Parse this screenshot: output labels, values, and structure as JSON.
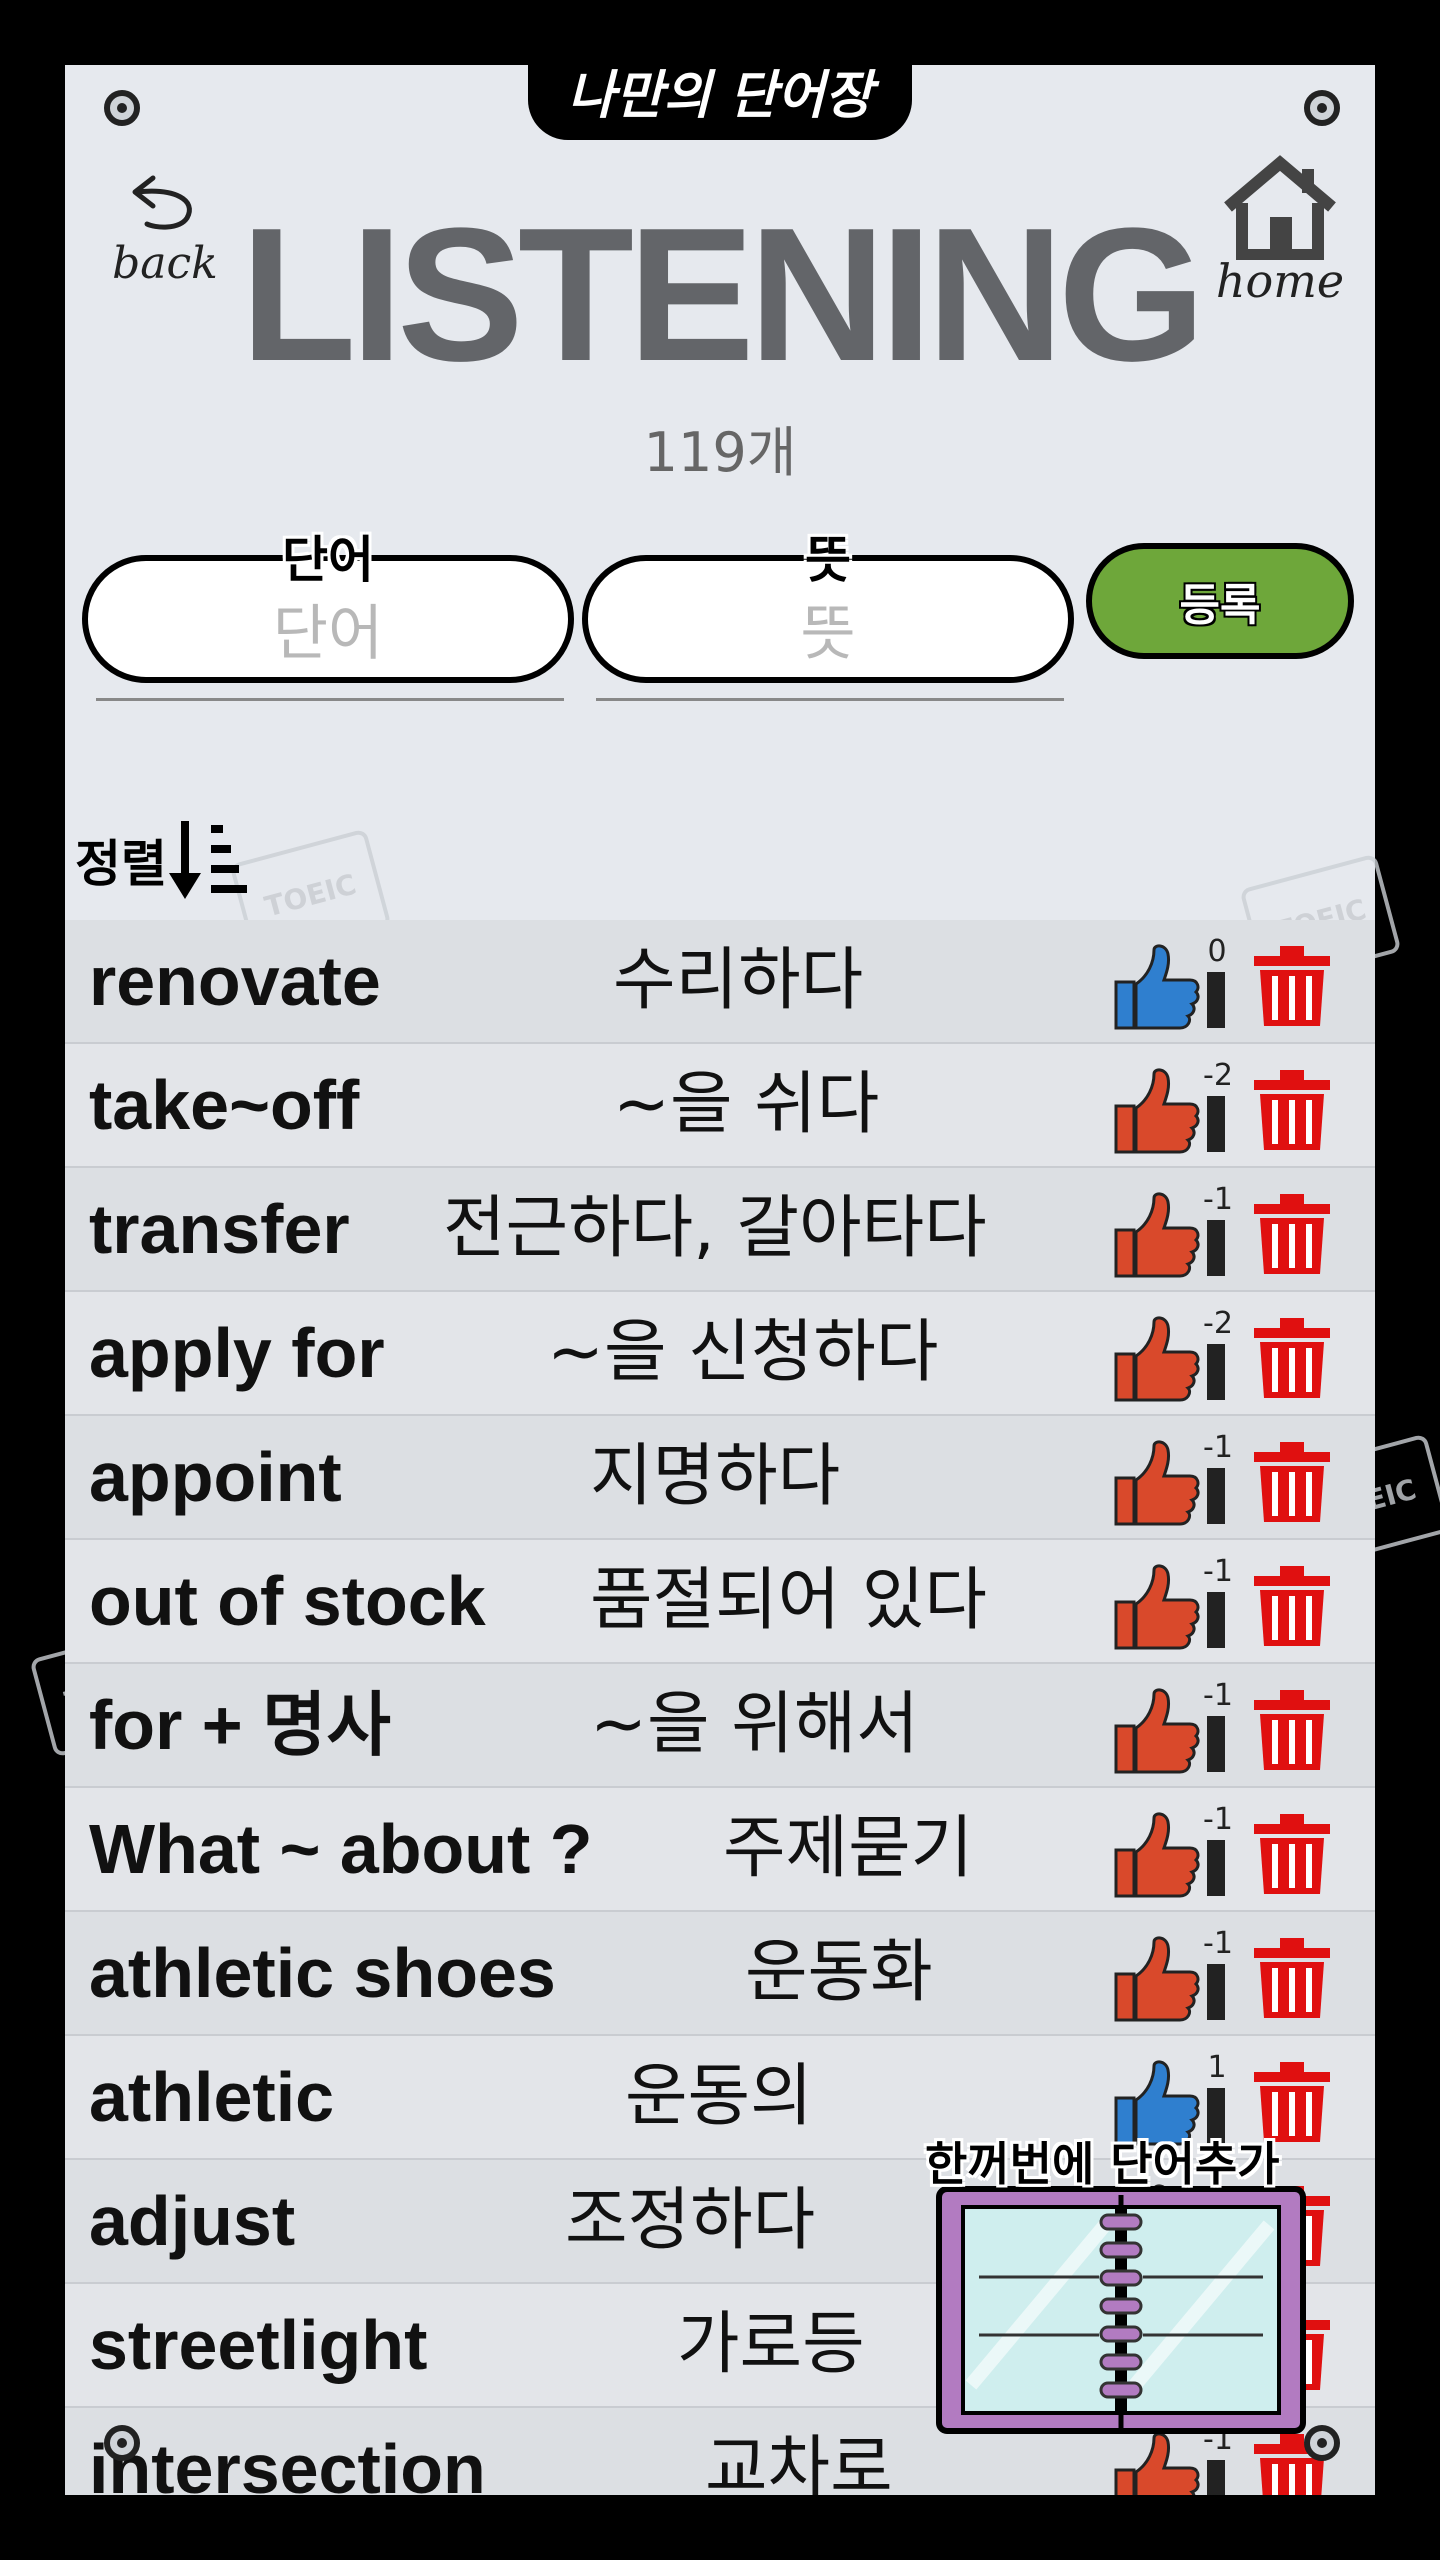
{
  "app": {
    "tab_title": "나만의 단어장"
  },
  "header": {
    "back_label": "back",
    "home_label": "home",
    "title": "LISTENING",
    "count": "119개"
  },
  "form": {
    "word_label": "단어",
    "word_placeholder": "단어",
    "meaning_label": "뜻",
    "meaning_placeholder": "뜻",
    "register_label": "등록"
  },
  "sort": {
    "label": "정렬"
  },
  "watermark_text": "TOEIC",
  "colors": {
    "like_positive": "#2f7fcf",
    "like_negative": "#d9492b",
    "trash": "#e01010",
    "register": "#6ea73a"
  },
  "words": [
    {
      "word": "renovate",
      "meaning": "수리하다",
      "score": "0",
      "thumb": "blue"
    },
    {
      "word": "take~off",
      "meaning": "~을 쉬다",
      "score": "-2",
      "thumb": "red"
    },
    {
      "word": "transfer",
      "meaning": "전근하다, 갈아타다",
      "score": "-1",
      "thumb": "red"
    },
    {
      "word": "apply for",
      "meaning": "~을 신청하다",
      "score": "-2",
      "thumb": "red"
    },
    {
      "word": "appoint",
      "meaning": "지명하다",
      "score": "-1",
      "thumb": "red"
    },
    {
      "word": "out of stock",
      "meaning": "품절되어 있다",
      "score": "-1",
      "thumb": "red"
    },
    {
      "word": "for + 명사",
      "meaning": "~을 위해서",
      "score": "-1",
      "thumb": "red"
    },
    {
      "word": "What ~ about ?",
      "meaning": "주제묻기",
      "score": "-1",
      "thumb": "red"
    },
    {
      "word": "athletic shoes",
      "meaning": "운동화",
      "score": "-1",
      "thumb": "red"
    },
    {
      "word": "athletic",
      "meaning": "운동의",
      "score": "1",
      "thumb": "blue"
    },
    {
      "word": "adjust",
      "meaning": "조정하다",
      "score": "",
      "thumb": "red"
    },
    {
      "word": "streetlight",
      "meaning": "가로등",
      "score": "",
      "thumb": "red"
    },
    {
      "word": "intersection",
      "meaning": "교차로",
      "score": "-1",
      "thumb": "red"
    }
  ],
  "bulk_add": {
    "label": "한꺼번에 단어추가"
  }
}
